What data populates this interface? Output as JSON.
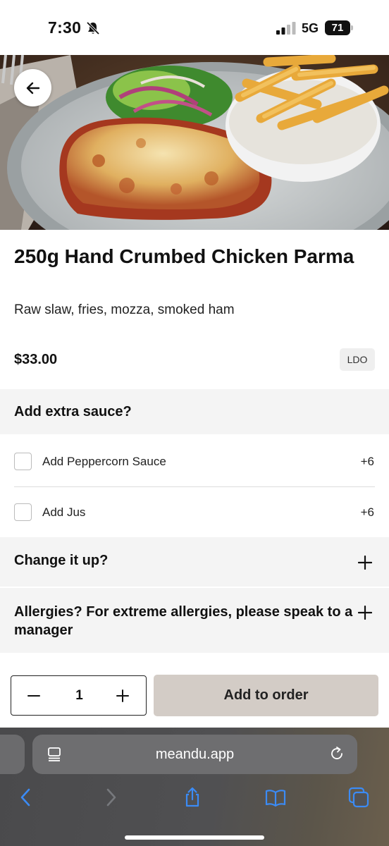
{
  "status_bar": {
    "time": "7:30",
    "network": "5G",
    "battery": "71"
  },
  "item": {
    "title": "250g Hand Crumbed Chicken Parma",
    "description": "Raw slaw, fries, mozza, smoked ham",
    "price": "$33.00",
    "tag": "LDO"
  },
  "sections": {
    "extra_sauce": {
      "title": "Add extra sauce?",
      "options": [
        {
          "label": "Add Peppercorn Sauce",
          "price": "+6",
          "checked": false
        },
        {
          "label": "Add Jus",
          "price": "+6",
          "checked": false
        }
      ]
    },
    "change_it_up": {
      "title": "Change it up?"
    },
    "allergies": {
      "title": "Allergies? For extreme allergies, please speak to a manager"
    }
  },
  "order": {
    "quantity": "1",
    "add_label": "Add to order",
    "button_color": "#d3ccc6"
  },
  "browser": {
    "url": "meandu.app",
    "accent": "#3b8bf5"
  }
}
